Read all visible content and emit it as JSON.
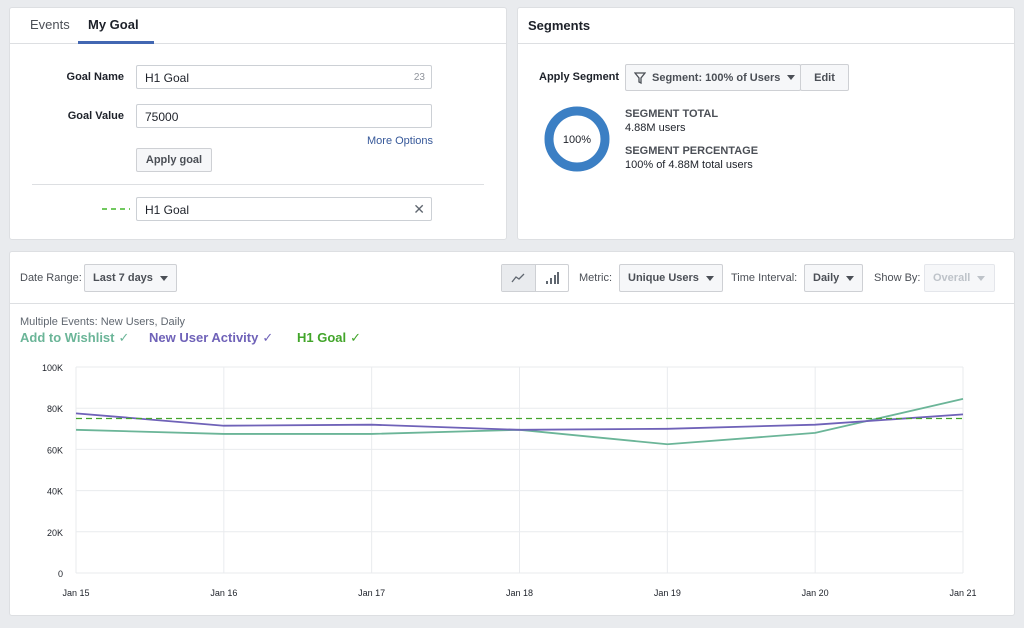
{
  "goal_panel": {
    "tabs": [
      "Events",
      "My Goal"
    ],
    "goal_name_label": "Goal Name",
    "goal_name_value": "H1 Goal",
    "goal_name_char_count": "23",
    "goal_value_label": "Goal Value",
    "goal_value_value": "75000",
    "more_options": "More Options",
    "apply_goal": "Apply goal",
    "applied_goal_label": "H1 Goal",
    "applied_goal_color": "#42b72a"
  },
  "segments_panel": {
    "title": "Segments",
    "apply_segment_label": "Apply Segment",
    "segment_dropdown": "Segment: 100% of Users",
    "edit_button": "Edit",
    "donut_label": "100%",
    "donut_fraction": 1.0,
    "donut_color": "#3b7fc4",
    "total_title": "SEGMENT TOTAL",
    "total_value": "4.88M users",
    "percentage_title": "SEGMENT PERCENTAGE",
    "percentage_value": "100% of 4.88M total users"
  },
  "toolbar": {
    "date_range_label": "Date Range:",
    "date_range_value": "Last 7 days",
    "metric_label": "Metric:",
    "metric_value": "Unique Users",
    "interval_label": "Time Interval:",
    "interval_value": "Daily",
    "show_by_label": "Show By:",
    "show_by_value": "Overall",
    "line_icon": "line-chart-icon",
    "bar_icon": "bar-chart-icon"
  },
  "chart_data": {
    "type": "line",
    "title": "Multiple Events: New Users, Daily",
    "x": [
      "Jan 15",
      "Jan 16",
      "Jan 17",
      "Jan 18",
      "Jan 19",
      "Jan 20",
      "Jan 21"
    ],
    "y_ticks": [
      "100K",
      "80K",
      "60K",
      "40K",
      "20K",
      "0"
    ],
    "ylim": [
      0,
      100000
    ],
    "grid": true,
    "series": [
      {
        "name": "Add to Wishlist",
        "color": "#6bb598",
        "values": [
          69500,
          67500,
          67500,
          69500,
          62500,
          68000,
          84500
        ],
        "dashed": false
      },
      {
        "name": "New User Activity",
        "color": "#6f62b8",
        "values": [
          77500,
          71500,
          72000,
          69500,
          70000,
          72000,
          77000
        ],
        "dashed": false
      },
      {
        "name": "H1 Goal",
        "color": "#42a52a",
        "values": [
          75000,
          75000,
          75000,
          75000,
          75000,
          75000,
          75000
        ],
        "dashed": true
      }
    ]
  }
}
